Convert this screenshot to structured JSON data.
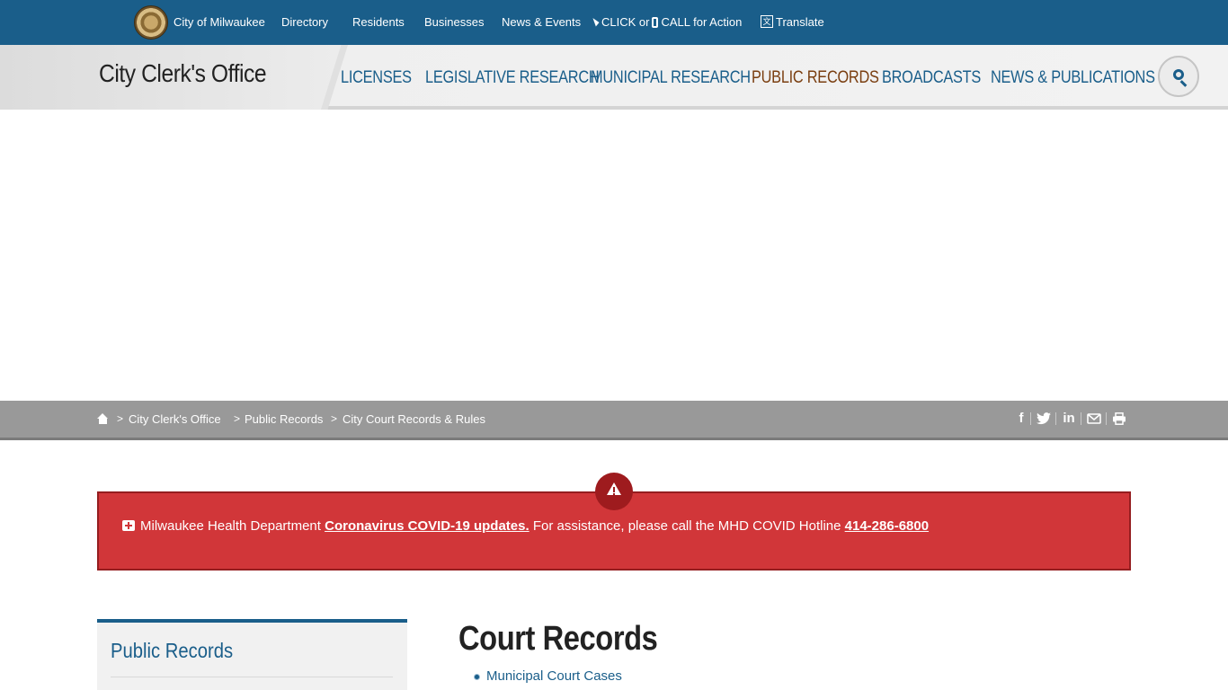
{
  "topbar": {
    "city": "City of Milwaukee",
    "directory": "Directory",
    "residents": "Residents",
    "businesses": "Businesses",
    "news_events": "News & Events",
    "action_click": "CLICK or",
    "action_call": "CALL for Action",
    "translate": "Translate"
  },
  "header": {
    "site_title": "City Clerk's Office",
    "nav": {
      "licenses": "LICENSES",
      "legislative": "LEGISLATIVE RESEARCH",
      "municipal": "MUNICIPAL RESEARCH",
      "public_records": "PUBLIC RECORDS",
      "broadcasts": "BROADCASTS",
      "news_publications": "NEWS & PUBLICATIONS"
    }
  },
  "breadcrumb": {
    "sep": ">",
    "clerk": "City Clerk's Office",
    "public_records": "Public Records",
    "current": "City Court Records & Rules"
  },
  "share": {
    "facebook": "f",
    "twitter": "t",
    "linkedin": "in"
  },
  "alert": {
    "lead": "Milwaukee Health Department",
    "link": "Coronavirus COVID-19 updates.",
    "middle": "For assistance, please call the MHD COVID Hotline",
    "phone": "414-286-6800"
  },
  "sidebar": {
    "title": "Public Records"
  },
  "main": {
    "title": "Court Records",
    "items": [
      "Municipal Court Cases"
    ]
  },
  "colors": {
    "primary": "#1a5e8a",
    "active_nav": "#7a3e10",
    "alert_bg": "#d13639",
    "breadcrumb_bg": "#999999"
  }
}
